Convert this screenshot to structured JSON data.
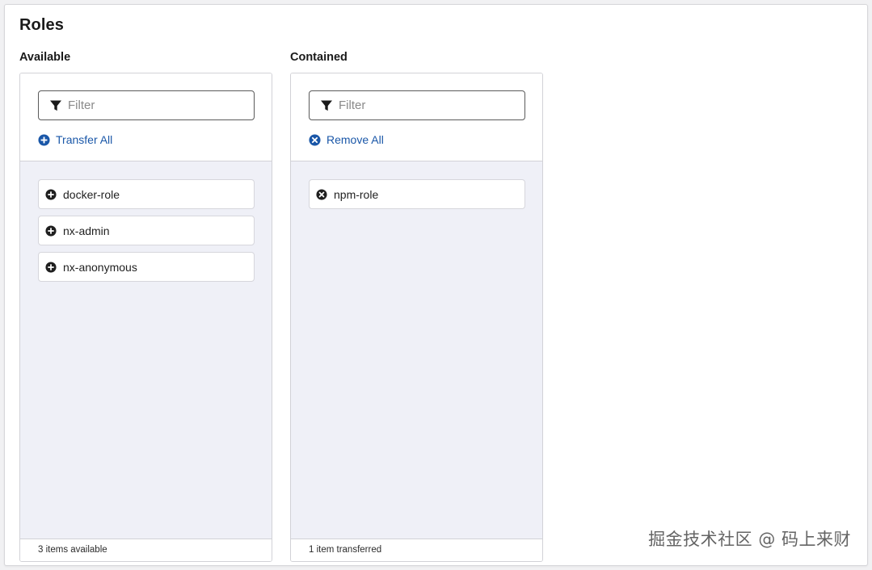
{
  "page": {
    "title": "Roles"
  },
  "available": {
    "label": "Available",
    "filter_placeholder": "Filter",
    "action_label": "Transfer All",
    "items": [
      {
        "label": "docker-role"
      },
      {
        "label": "nx-admin"
      },
      {
        "label": "nx-anonymous"
      }
    ],
    "footer": "3 items available"
  },
  "contained": {
    "label": "Contained",
    "filter_placeholder": "Filter",
    "action_label": "Remove All",
    "items": [
      {
        "label": "npm-role"
      }
    ],
    "footer": "1 item transferred"
  },
  "icons": {
    "filter": "filter-funnel-icon",
    "transfer_all": "plus-circle-icon",
    "remove_all": "times-circle-icon",
    "add_item": "plus-circle-icon",
    "remove_item": "times-circle-icon"
  },
  "colors": {
    "link": "#1a57a8",
    "list_background": "#eff0f7",
    "border": "#d2d2d7"
  },
  "watermark": "掘金技术社区 @ 码上来财"
}
